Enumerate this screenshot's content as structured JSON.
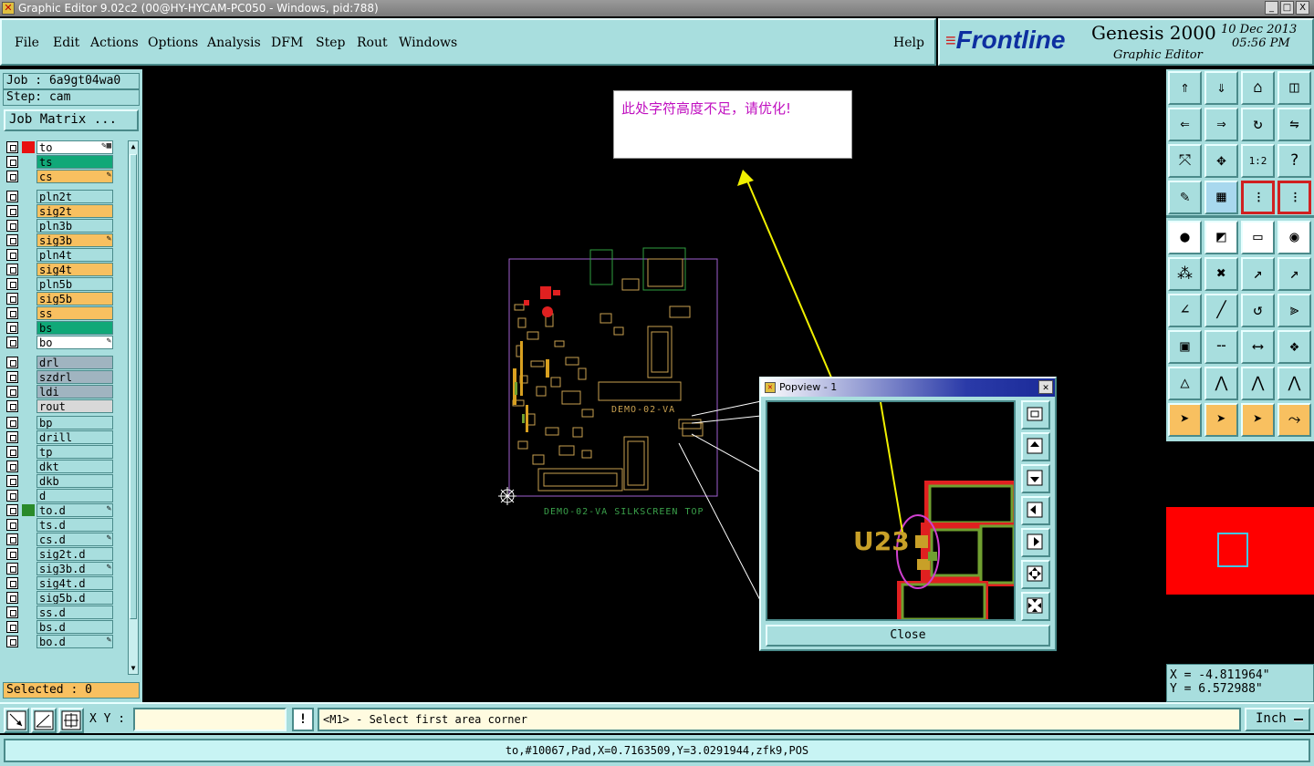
{
  "window": {
    "title": "Graphic Editor 9.02c2 (00@HY-HYCAM-PC050 - Windows, pid:788)",
    "buttons": [
      "_",
      "□",
      "X"
    ]
  },
  "menu": {
    "items": [
      "File",
      "Edit",
      "Actions",
      "Options",
      "Analysis",
      "DFM",
      "Step",
      "Rout",
      "Windows"
    ],
    "help": "Help"
  },
  "logo": {
    "brand": "Frontline",
    "product": "Genesis 2000",
    "subtitle": "Graphic Editor",
    "date": "10 Dec 2013",
    "time": "05:56 PM"
  },
  "left": {
    "job": "Job : 6a9gt04wa0",
    "step": "Step: cam",
    "job_matrix": "Job Matrix ...",
    "selected": "Selected : 0",
    "layers": [
      {
        "name": "to",
        "bg": "#ffffff",
        "swatch": "#e81010",
        "flag": "✎▦"
      },
      {
        "name": "ts",
        "bg": "#10a878",
        "swatch": "",
        "flag": ""
      },
      {
        "name": "cs",
        "bg": "#f8c060",
        "swatch": "",
        "flag": "✎"
      },
      {
        "name": "pln2t",
        "bg": "#a8dede",
        "swatch": "",
        "flag": ""
      },
      {
        "name": "sig2t",
        "bg": "#f8c060",
        "swatch": "",
        "flag": ""
      },
      {
        "name": "pln3b",
        "bg": "#a8dede",
        "swatch": "",
        "flag": ""
      },
      {
        "name": "sig3b",
        "bg": "#f8c060",
        "swatch": "",
        "flag": "✎"
      },
      {
        "name": "pln4t",
        "bg": "#a8dede",
        "swatch": "",
        "flag": ""
      },
      {
        "name": "sig4t",
        "bg": "#f8c060",
        "swatch": "",
        "flag": ""
      },
      {
        "name": "pln5b",
        "bg": "#a8dede",
        "swatch": "",
        "flag": ""
      },
      {
        "name": "sig5b",
        "bg": "#f8c060",
        "swatch": "",
        "flag": ""
      },
      {
        "name": "ss",
        "bg": "#f8c060",
        "swatch": "",
        "flag": ""
      },
      {
        "name": "bs",
        "bg": "#10a878",
        "swatch": "",
        "flag": ""
      },
      {
        "name": "bo",
        "bg": "#ffffff",
        "swatch": "",
        "flag": "✎"
      },
      {
        "name": "drl",
        "bg": "#a0b4c0",
        "swatch": "",
        "flag": ""
      },
      {
        "name": "szdrl",
        "bg": "#a0b4c0",
        "swatch": "",
        "flag": ""
      },
      {
        "name": "ldi",
        "bg": "#a0b4c0",
        "swatch": "",
        "flag": ""
      },
      {
        "name": "rout",
        "bg": "#d8d8d8",
        "swatch": "",
        "flag": ""
      },
      {
        "name": "bp",
        "bg": "#a8dede",
        "swatch": "",
        "flag": ""
      },
      {
        "name": "drill",
        "bg": "#a8dede",
        "swatch": "",
        "flag": ""
      },
      {
        "name": "tp",
        "bg": "#a8dede",
        "swatch": "",
        "flag": ""
      },
      {
        "name": "dkt",
        "bg": "#a8dede",
        "swatch": "",
        "flag": ""
      },
      {
        "name": "dkb",
        "bg": "#a8dede",
        "swatch": "",
        "flag": ""
      },
      {
        "name": "d",
        "bg": "#a8dede",
        "swatch": "",
        "flag": ""
      },
      {
        "name": "to.d",
        "bg": "#a8dede",
        "swatch": "#2a8a2a",
        "flag": "✎"
      },
      {
        "name": "ts.d",
        "bg": "#a8dede",
        "swatch": "",
        "flag": ""
      },
      {
        "name": "cs.d",
        "bg": "#a8dede",
        "swatch": "",
        "flag": "✎"
      },
      {
        "name": "sig2t.d",
        "bg": "#a8dede",
        "swatch": "",
        "flag": ""
      },
      {
        "name": "sig3b.d",
        "bg": "#a8dede",
        "swatch": "",
        "flag": "✎"
      },
      {
        "name": "sig4t.d",
        "bg": "#a8dede",
        "swatch": "",
        "flag": ""
      },
      {
        "name": "sig5b.d",
        "bg": "#a8dede",
        "swatch": "",
        "flag": ""
      },
      {
        "name": "ss.d",
        "bg": "#a8dede",
        "swatch": "",
        "flag": ""
      },
      {
        "name": "bs.d",
        "bg": "#a8dede",
        "swatch": "",
        "flag": ""
      },
      {
        "name": "bo.d",
        "bg": "#a8dede",
        "swatch": "",
        "flag": "✎"
      }
    ]
  },
  "canvas": {
    "annotation": "此处字符高度不足，请优化!",
    "board_label": "DEMO-02-VA SILKSCREEN TOP",
    "board_inner_label": "DEMO-02-VA"
  },
  "popview": {
    "title": "Popview - 1",
    "refdes": "U23",
    "close": "Close",
    "tools": [
      "zoom-window-icon",
      "pan-up-icon",
      "pan-down-icon",
      "pan-left-icon",
      "pan-right-icon",
      "zoom-out-icon",
      "zoom-in-icon"
    ]
  },
  "coords": {
    "x": "X = -4.811964\"",
    "y": "Y = 6.572988\""
  },
  "command": {
    "xy_label": "X Y :",
    "xy_value": "",
    "prompt": "<M1> - Select first area corner",
    "units": "Inch"
  },
  "status": "to,#10067,Pad,X=0.7163509,Y=3.0291944,zfk9,POS",
  "toolbox": {
    "icons": [
      "move-up-icon",
      "move-down-icon",
      "home-icon",
      "split-view-icon",
      "move-left-icon",
      "move-right-icon",
      "rotate-icon",
      "mirror-icon",
      "zoom-fit-icon",
      "center-icon",
      "scale-1-2-icon",
      "help-icon",
      "tools-icon",
      "grid-icon",
      "layers-icon",
      "layers-active-icon",
      "pad-add-icon",
      "line-add-icon",
      "ruler-icon",
      "circle-icon",
      "node-link-icon",
      "cross-icon",
      "snap-point-icon",
      "snap-end-icon",
      "angle-icon",
      "diagonal-icon",
      "arc-icon",
      "feature-icon",
      "pad-select-icon",
      "split-line-icon",
      "measure-icon",
      "surface-icon",
      "triangle-icon",
      "arch-icon",
      "arch-fill-icon",
      "arch-cross-icon",
      "pointer-icon",
      "pointer-box-icon",
      "pointer-alt-icon",
      "route-icon"
    ]
  }
}
